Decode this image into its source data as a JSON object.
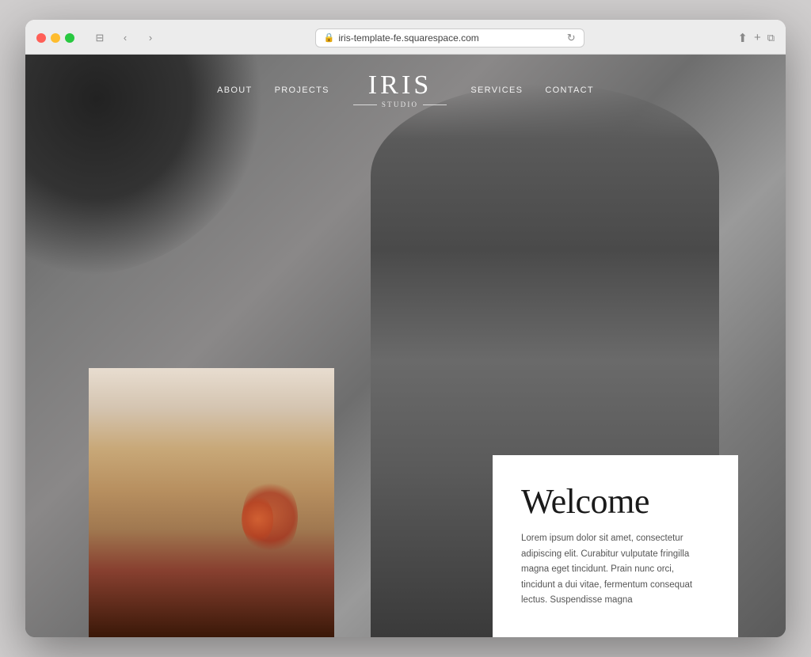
{
  "browser": {
    "url": "iris-template-fe.squarespace.com",
    "traffic_lights": {
      "red": "red",
      "yellow": "yellow",
      "green": "green"
    },
    "back_btn": "‹",
    "forward_btn": "›"
  },
  "nav": {
    "logo_name": "IRIS",
    "logo_sub": "STUDIO",
    "links_left": [
      {
        "label": "ABOUT"
      },
      {
        "label": "PROJECTS"
      }
    ],
    "links_right": [
      {
        "label": "SERVICES"
      },
      {
        "label": "CONTACT"
      }
    ]
  },
  "welcome": {
    "title": "Welcome",
    "body": "Lorem ipsum dolor sit amet, consectetur adipiscing elit. Curabitur vulputate fringilla magna eget tincidunt. Prain nunc orci, tincidunt a dui vitae, fermentum consequat lectus. Suspendisse magna"
  }
}
